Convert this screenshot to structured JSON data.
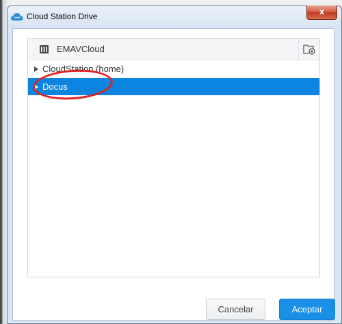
{
  "window": {
    "title": "Cloud Station Drive",
    "close_symbol": "x"
  },
  "tree": {
    "header_label": "EMAVCloud",
    "header_icon": "server-icon",
    "new_folder_icon": "new-folder-icon",
    "items": [
      {
        "label": "CloudStation (home)",
        "selected": false
      },
      {
        "label": "Docus",
        "selected": true
      }
    ]
  },
  "buttons": {
    "cancel": "Cancelar",
    "ok": "Aceptar"
  },
  "colors": {
    "selection": "#0b85e0",
    "primary_button": "#1a8fe6",
    "highlight_circle": "#e32222"
  }
}
